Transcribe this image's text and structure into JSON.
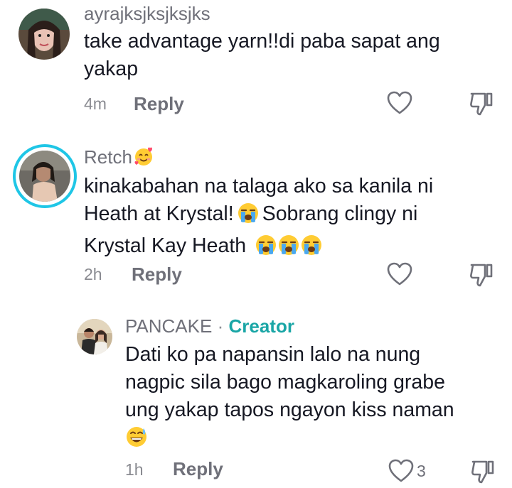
{
  "comments": [
    {
      "username": "ayrajksjksjksjks",
      "lines": [
        "take advantage yarn!!di paba sapat ang",
        "yakap"
      ],
      "time": "4m",
      "reply_label": "Reply"
    },
    {
      "username": "Retch",
      "username_emoji": "smiling-face-with-hearts",
      "lines": [
        "kinakabahan na talaga ako sa kanila ni",
        "Heath at Krystal!",
        "Sobrang clingy ni",
        "Krystal Kay Heath"
      ],
      "time": "2h",
      "reply_label": "Reply"
    }
  ],
  "reply": {
    "username": "PANCAKE",
    "separator": "·",
    "creator_label": "Creator",
    "lines": [
      "Dati ko pa napansin lalo na nung",
      "nagpic sila bago magkaroling grabe",
      "ung yakap tapos ngayon kiss naman"
    ],
    "time": "1h",
    "reply_label": "Reply",
    "like_count": "3"
  },
  "colors": {
    "creator": "#1aa6a6",
    "story_ring": "#1fc6e6",
    "muted": "#8a8b91"
  },
  "icons": [
    "heart-outline-icon",
    "thumbs-down-outline-icon",
    "loudly-crying-face-emoji",
    "grinning-sweat-emoji",
    "smiling-face-with-hearts-emoji"
  ]
}
